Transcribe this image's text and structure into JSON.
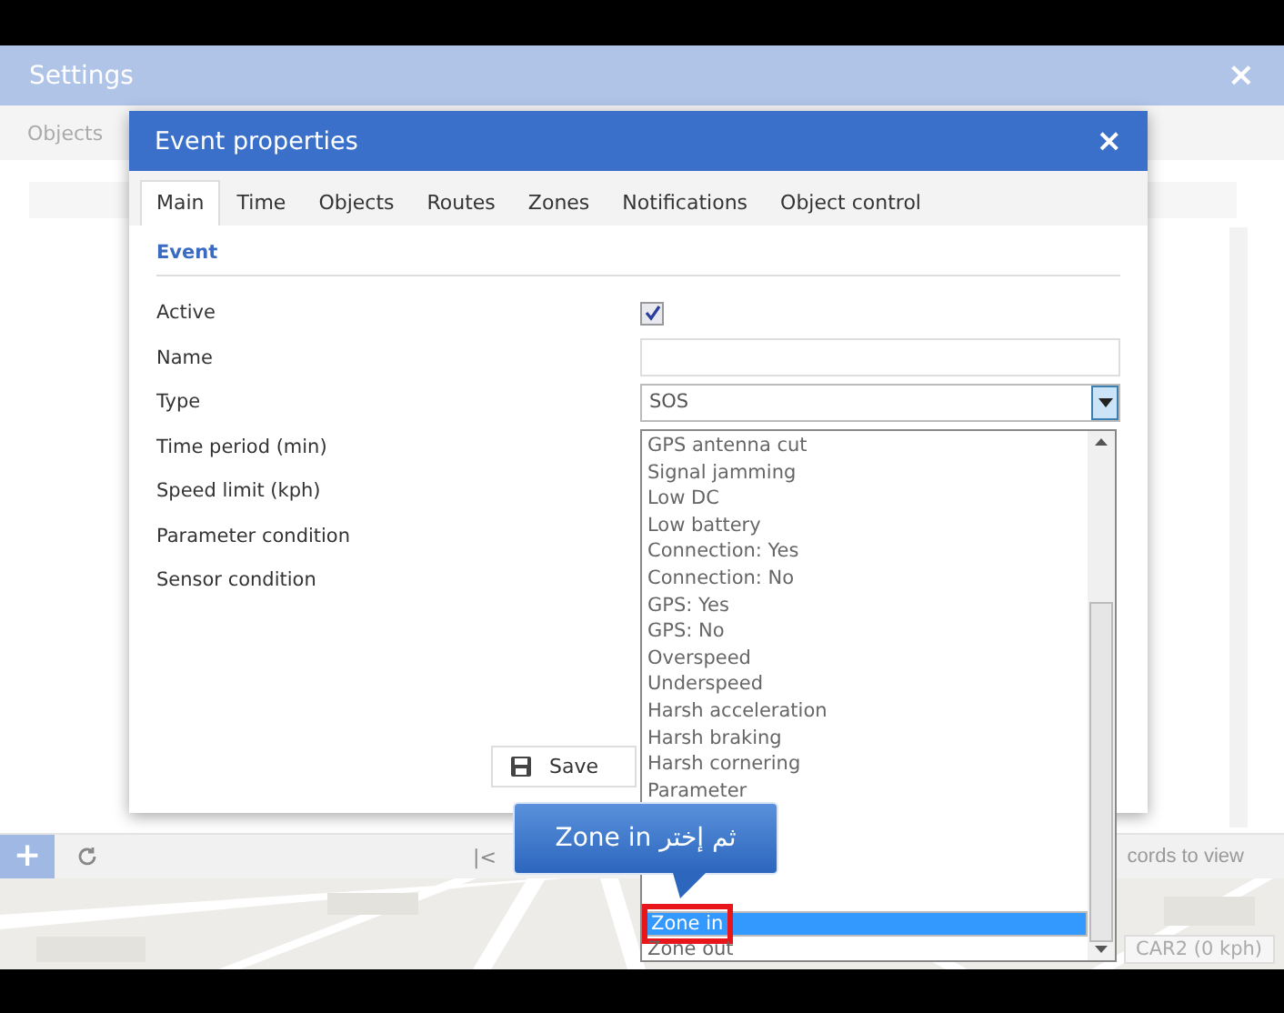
{
  "settings": {
    "title": "Settings",
    "close": "×",
    "tabs": [
      {
        "label": "Objects"
      }
    ],
    "toolbar": {
      "add": "+",
      "first_page": "|<",
      "records_text": "cords to view"
    },
    "map": {
      "kind": "picture",
      "marker_label": "CAR2 (0 kph)"
    }
  },
  "dialog": {
    "title": "Event properties",
    "close": "×",
    "tabs": [
      {
        "label": "Main",
        "selected": true
      },
      {
        "label": "Time",
        "selected": false
      },
      {
        "label": "Objects",
        "selected": false
      },
      {
        "label": "Routes",
        "selected": false
      },
      {
        "label": "Zones",
        "selected": false
      },
      {
        "label": "Notifications",
        "selected": false
      },
      {
        "label": "Object control",
        "selected": false
      }
    ],
    "section": "Event",
    "fields": [
      {
        "label": "Active",
        "kind": "checkbox",
        "checked": true
      },
      {
        "label": "Name",
        "kind": "text"
      },
      {
        "label": "Type",
        "kind": "select",
        "value": "SOS",
        "expanded": true
      },
      {
        "label": "Time period (min)",
        "kind": "label"
      },
      {
        "label": "Speed limit (kph)",
        "kind": "label"
      },
      {
        "label": "Parameter condition",
        "kind": "label"
      },
      {
        "label": "Sensor condition",
        "kind": "label"
      }
    ],
    "save": "Save",
    "options": [
      {
        "label": "GPS antenna cut",
        "selected": false
      },
      {
        "label": "Signal jamming",
        "selected": false
      },
      {
        "label": "Low DC",
        "selected": false
      },
      {
        "label": "Low battery",
        "selected": false
      },
      {
        "label": "Connection: Yes",
        "selected": false
      },
      {
        "label": "Connection: No",
        "selected": false
      },
      {
        "label": "GPS: Yes",
        "selected": false
      },
      {
        "label": "GPS: No",
        "selected": false
      },
      {
        "label": "Overspeed",
        "selected": false
      },
      {
        "label": "Underspeed",
        "selected": false
      },
      {
        "label": "Harsh acceleration",
        "selected": false
      },
      {
        "label": "Harsh braking",
        "selected": false
      },
      {
        "label": "Harsh cornering",
        "selected": false
      },
      {
        "label": "Parameter",
        "selected": false
      },
      {
        "label": "Zone in",
        "selected": true,
        "highlighted": true
      },
      {
        "label": "Zone out",
        "selected": false
      }
    ]
  },
  "callout": {
    "text": "ثم إختر Zone in"
  }
}
